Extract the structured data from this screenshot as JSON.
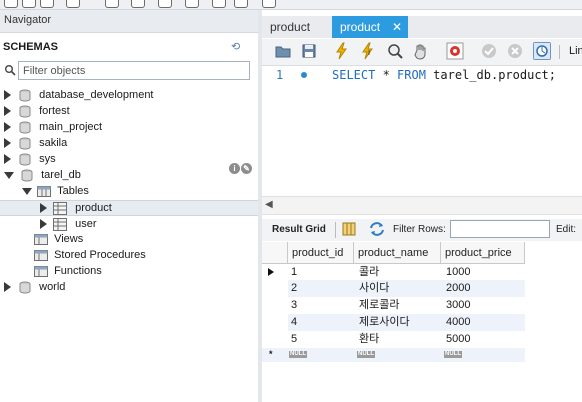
{
  "navigator": {
    "title": "Navigator",
    "schemas_label": "SCHEMAS",
    "filter_placeholder": "Filter objects",
    "schemas": [
      "database_development",
      "fortest",
      "main_project",
      "sakila",
      "sys",
      "tarel_db",
      "world"
    ],
    "tarel_children": {
      "tables_label": "Tables",
      "tables": [
        "product",
        "user"
      ],
      "views_label": "Views",
      "procedures_label": "Stored Procedures",
      "functions_label": "Functions"
    }
  },
  "tabs": [
    "product",
    "product"
  ],
  "toolbar": {
    "limit_label": "Lin"
  },
  "editor": {
    "line_number": "1",
    "kw_select": "SELECT",
    "star": " * ",
    "kw_from": "FROM",
    "table_ref": " tarel_db.product;"
  },
  "results": {
    "grid_label": "Result Grid",
    "filter_rows_label": "Filter Rows:",
    "edit_label": "Edit:",
    "columns": [
      "product_id",
      "product_name",
      "product_price"
    ],
    "rows": [
      [
        "1",
        "콜라",
        "1000"
      ],
      [
        "2",
        "사이다",
        "2000"
      ],
      [
        "3",
        "제로콜라",
        "3000"
      ],
      [
        "4",
        "제로사이다",
        "4000"
      ],
      [
        "5",
        "환타",
        "5000"
      ]
    ],
    "null_label": "NULL",
    "new_row_marker": "*"
  },
  "colors": {
    "accent": "#2c9be0",
    "keyword": "#1e6cc2",
    "stripe": "#eef3fb"
  }
}
